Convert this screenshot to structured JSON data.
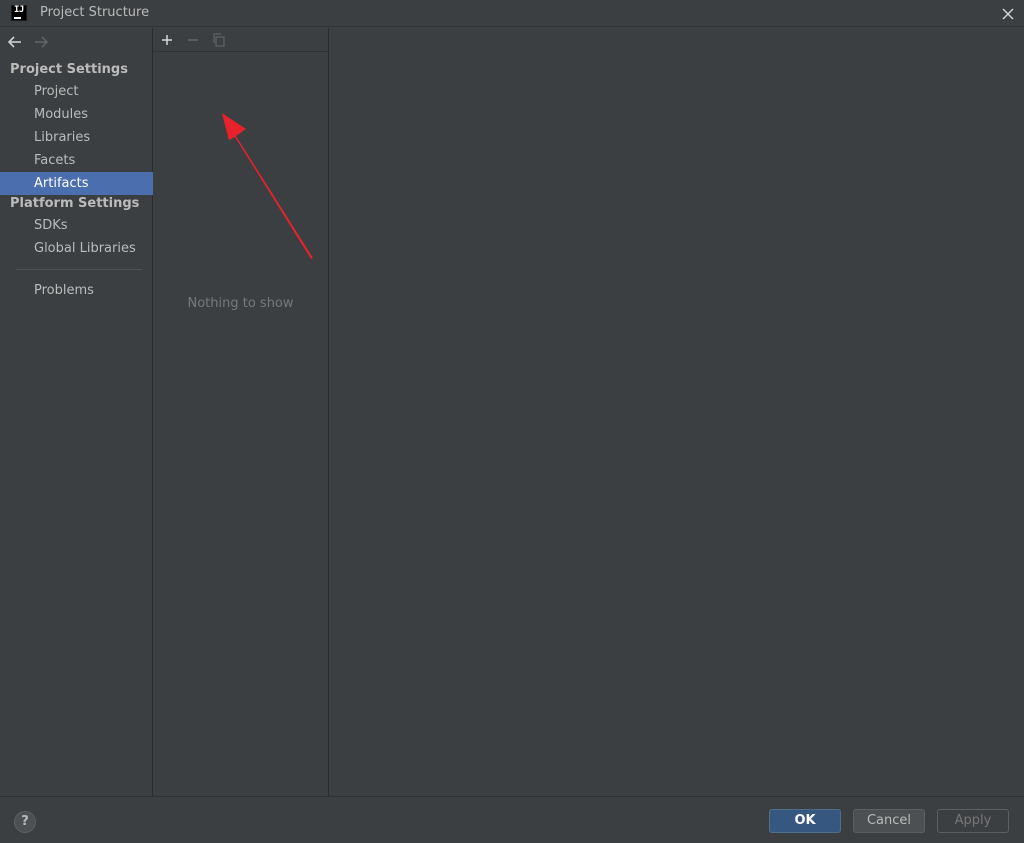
{
  "window": {
    "title": "Project Structure",
    "app_icon_text": "IJ"
  },
  "sidebar": {
    "project_settings_header": "Project Settings",
    "project_items": [
      {
        "label": "Project"
      },
      {
        "label": "Modules"
      },
      {
        "label": "Libraries"
      },
      {
        "label": "Facets"
      },
      {
        "label": "Artifacts",
        "selected": true
      }
    ],
    "platform_settings_header": "Platform Settings",
    "platform_items": [
      {
        "label": "SDKs"
      },
      {
        "label": "Global Libraries"
      }
    ],
    "problems_label": "Problems"
  },
  "list_panel": {
    "toolbar_icons": [
      "add-icon",
      "remove-icon",
      "copy-icon"
    ],
    "empty_text": "Nothing to show"
  },
  "footer": {
    "help_label": "?",
    "ok_label": "OK",
    "cancel_label": "Cancel",
    "apply_label": "Apply"
  },
  "colors": {
    "background": "#3c3f41",
    "selection": "#4b6eaf",
    "ok_button": "#365880",
    "annotation_arrow": "#e8222a"
  }
}
